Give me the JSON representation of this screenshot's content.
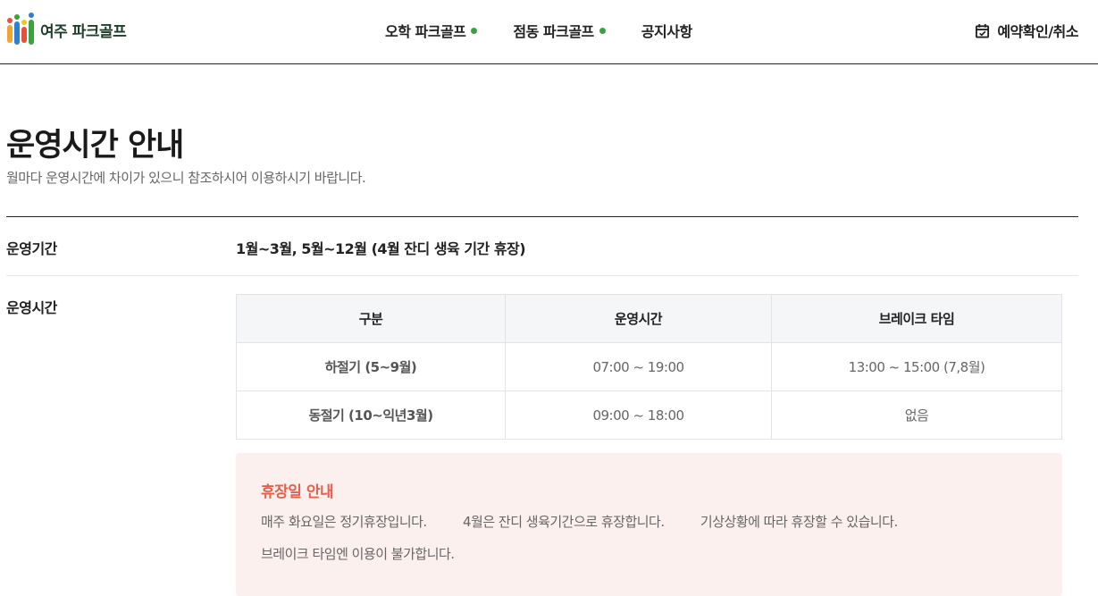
{
  "header": {
    "logo_text": "여주 파크골프",
    "nav": [
      {
        "label": "오학 파크골프",
        "dot": true
      },
      {
        "label": "점동 파크골프",
        "dot": true
      },
      {
        "label": "공지사항",
        "dot": false
      }
    ],
    "reserve_label": "예약확인/취소",
    "dot_color": "#3aa23e"
  },
  "main": {
    "title": "운영시간 안내",
    "subtitle": "월마다 운영시간에 차이가 있으니 참조하시어 이용하시기 바랍니다.",
    "period": {
      "label": "운영기간",
      "value": "1월~3월, 5월~12월 (4월 잔디 생육 기간 휴장)"
    },
    "hours": {
      "label": "운영시간",
      "headers": [
        "구분",
        "운영시간",
        "브레이크 타임"
      ],
      "rows": [
        [
          "하절기 (5~9월)",
          "07:00 ~ 19:00",
          "13:00 ~ 15:00 (7,8월)"
        ],
        [
          "동절기 (10~익년3월)",
          "09:00 ~ 18:00",
          "없음"
        ]
      ]
    },
    "closure": {
      "title": "휴장일 안내",
      "line1": [
        "매주 화요일은 정기휴장입니다.",
        "4월은 잔디 생육기간으로 휴장합니다.",
        "기상상황에 따라 휴장할 수 있습니다."
      ],
      "line2": "브레이크 타임엔 이용이 불가합니다.",
      "title_color": "#e8604c",
      "bg_color": "#fbf0ee"
    }
  }
}
